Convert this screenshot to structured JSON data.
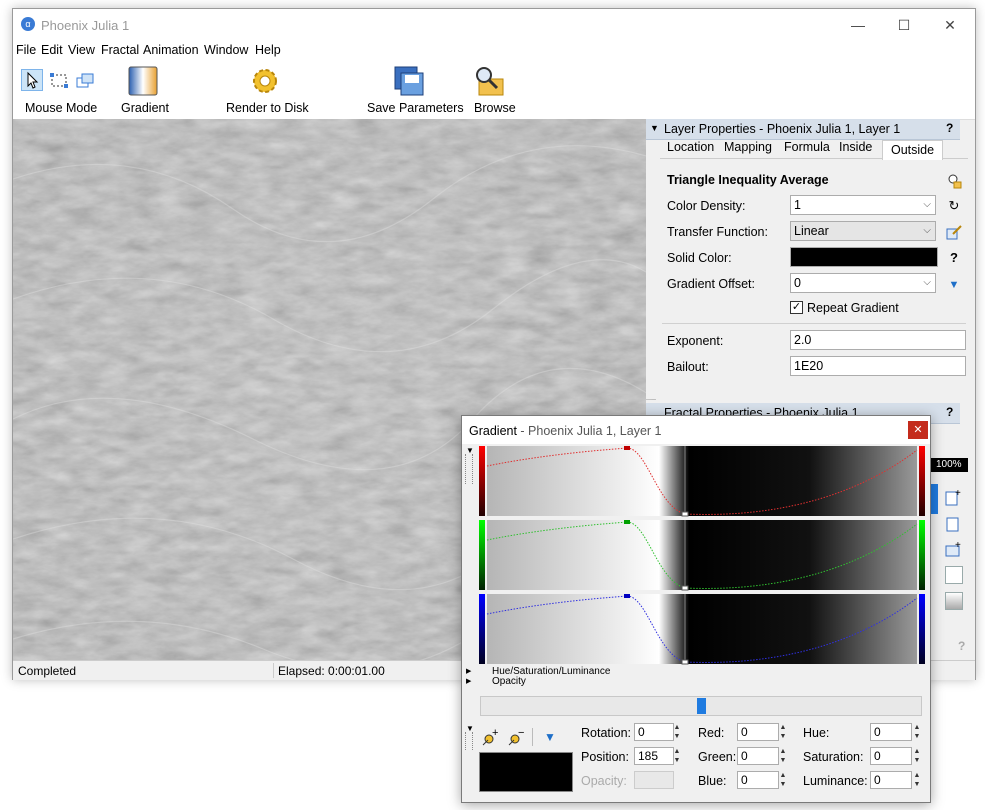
{
  "window": {
    "title": "Phoenix Julia 1",
    "minimize": "—",
    "maximize": "☐",
    "close": "✕",
    "app_icon": "α"
  },
  "menu": [
    "File",
    "Edit",
    "View",
    "Fractal",
    "Animation",
    "Window",
    "Help"
  ],
  "toolbar": {
    "mouse_mode": "Mouse Mode",
    "gradient": "Gradient",
    "render": "Render to Disk",
    "save": "Save Parameters",
    "browse": "Browse"
  },
  "status": {
    "left": "Completed",
    "elapsed": "Elapsed: 0:00:01.00"
  },
  "layer_panel": {
    "title": "Layer Properties - Phoenix Julia 1, Layer 1",
    "help": "?",
    "tabs": [
      "Location",
      "Mapping",
      "Formula",
      "Inside",
      "Outside"
    ],
    "active_tab": "Outside",
    "section_title": "Triangle Inequality Average",
    "color_density_label": "Color Density:",
    "color_density": "1",
    "transfer_label": "Transfer Function:",
    "transfer": "Linear",
    "solid_color_label": "Solid Color:",
    "solid_color": "#000000",
    "offset_label": "Gradient Offset:",
    "offset": "0",
    "repeat_label": "Repeat Gradient",
    "repeat_checked": "✓",
    "exponent_label": "Exponent:",
    "exponent": "2.0",
    "bailout_label": "Bailout:",
    "bailout": "1E20",
    "help_q": "?"
  },
  "fractal_panel": {
    "title": "Fractal Properties - Phoenix Julia 1",
    "help": "?",
    "zoom": "100%",
    "help2": "?"
  },
  "gradient_dialog": {
    "title": "Gradient",
    "subtitle": " - Phoenix Julia 1, Layer 1",
    "close": "✕",
    "hsl_label": "Hue/Saturation/Luminance",
    "opacity_section_label": "Opacity",
    "rotation_label": "Rotation:",
    "rotation": "0",
    "position_label": "Position:",
    "position": "185",
    "opacity_label": "Opacity:",
    "opacity": "",
    "red_label": "Red:",
    "red": "0",
    "green_label": "Green:",
    "green": "0",
    "blue_label": "Blue:",
    "blue": "0",
    "hue_label": "Hue:",
    "hue": "0",
    "saturation_label": "Saturation:",
    "saturation": "0",
    "luminance_label": "Luminance:",
    "luminance": "0",
    "slider_position": 0.5
  },
  "colors": {
    "accent": "#0078d7",
    "red": "#e00000",
    "green": "#00c000",
    "blue": "#0000e0",
    "header": "#d6dfea"
  }
}
